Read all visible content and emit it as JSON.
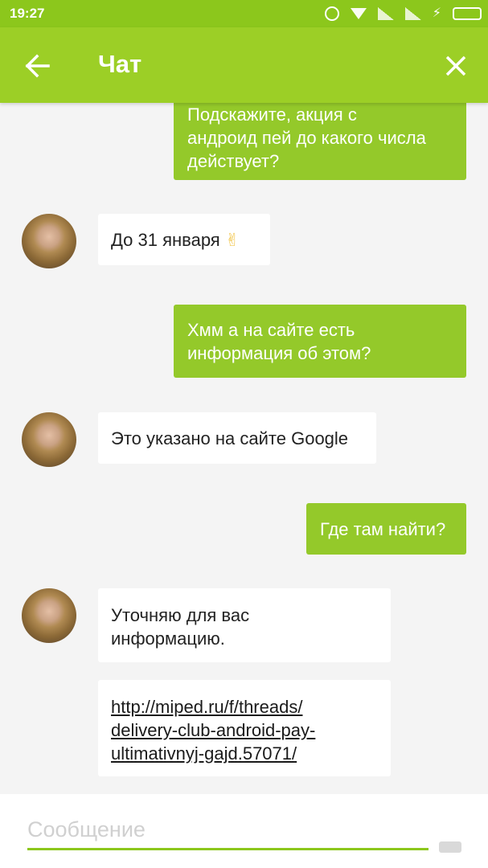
{
  "status_bar": {
    "time": "19:27",
    "icons": [
      "alarm-icon",
      "wifi-icon",
      "signal-icon",
      "signal-icon",
      "charging-icon",
      "battery-icon"
    ]
  },
  "app_bar": {
    "title": "Чат",
    "back_icon": "arrow-left-icon",
    "close_icon": "close-icon"
  },
  "messages": [
    {
      "from": "user",
      "lines": [
        "Подскажите, акция с",
        "андроид пей до какого числа",
        "действует?"
      ]
    },
    {
      "from": "agent",
      "text": "До 31 января",
      "emoji": "✌"
    },
    {
      "from": "user",
      "lines": [
        "Хмм а на сайте есть",
        "информация об этом?"
      ]
    },
    {
      "from": "agent",
      "text": "Это указано на сайте Google"
    },
    {
      "from": "user",
      "text": "Где там найти?"
    },
    {
      "from": "agent",
      "lines": [
        "Уточняю для вас",
        "информацию."
      ]
    },
    {
      "from": "agent",
      "link_lines": [
        "http://miped.ru/f/threads/",
        "delivery-club-android-pay-",
        "ultimativnyj-gajd.57071/"
      ]
    }
  ],
  "composer": {
    "placeholder": "Сообщение",
    "value": ""
  },
  "colors": {
    "status_bar": "#8cc71c",
    "app_bar": "#9ccf26",
    "outgoing_bubble": "#94c92a",
    "incoming_bubble": "#ffffff",
    "background": "#f4f4f4"
  }
}
